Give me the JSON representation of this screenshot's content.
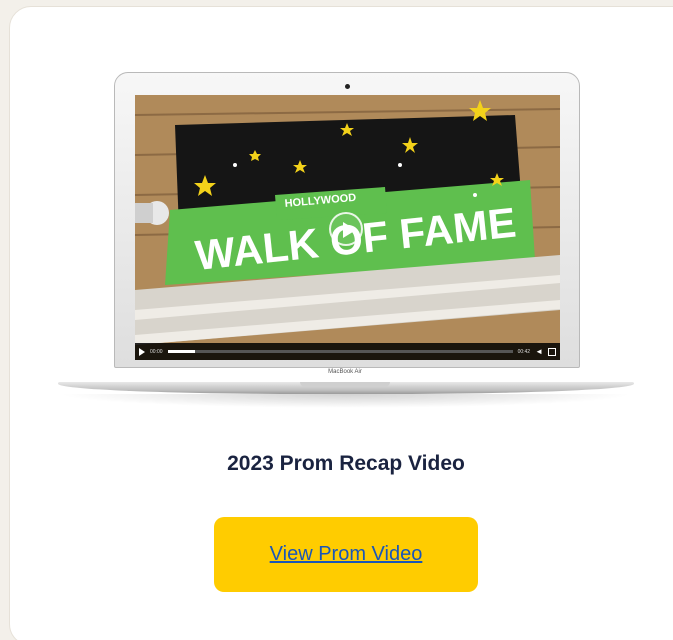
{
  "card": {
    "title": "2023 Prom Recap Video",
    "button_label": "View Prom Video"
  },
  "laptop": {
    "brand_label": "MacBook Air"
  },
  "video": {
    "sign_small_text": "HOLLYWOOD",
    "sign_text": "WALK OF FAME",
    "current_time": "00:00",
    "duration": "00:42",
    "progress_fraction": 0.08
  },
  "colors": {
    "page_background": "#f3f0ea",
    "card_background": "#ffffff",
    "title_color": "#1a2340",
    "button_background": "#ffcc00",
    "button_text": "#1a56b8",
    "sign_green": "#5fbf4e"
  },
  "icons": [
    "play-icon",
    "big-play-icon",
    "volume-icon",
    "fullscreen-icon",
    "star-icon"
  ]
}
